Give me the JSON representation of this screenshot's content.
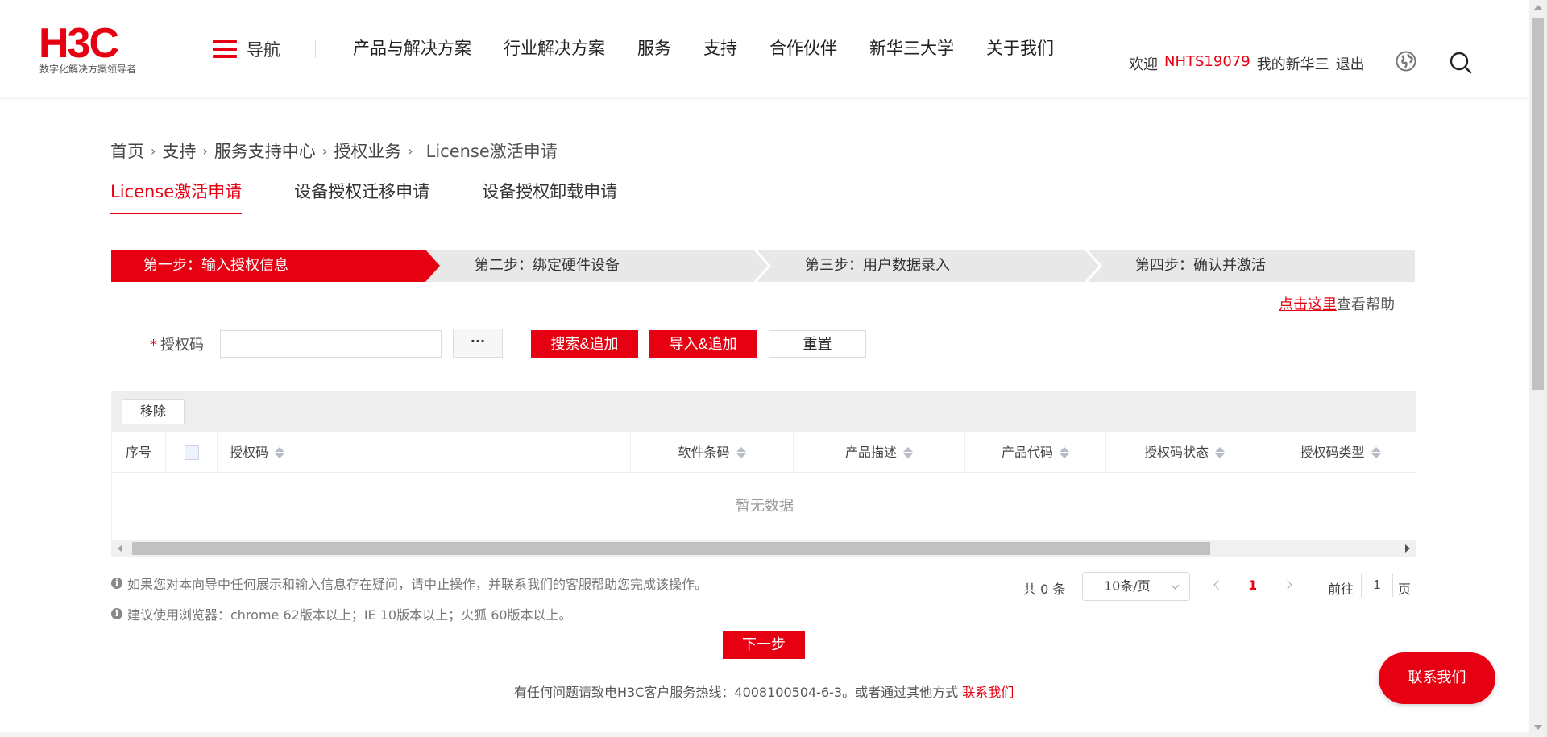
{
  "colors": {
    "brand_red": "#e60012",
    "step_inactive_bg": "#e8e8e8"
  },
  "header": {
    "logo_text": "H3C",
    "logo_slogan": "数字化解决方案领导者",
    "nav_toggle_label": "导航",
    "nav_items": [
      "产品与解决方案",
      "行业解决方案",
      "服务",
      "支持",
      "合作伙伴",
      "新华三大学",
      "关于我们"
    ],
    "welcome": "欢迎",
    "username": "NHTS19079",
    "my_h3c": "我的新华三",
    "logout": "退出",
    "globe_icon": "globe-icon",
    "search_icon": "search-icon"
  },
  "breadcrumb": {
    "items": [
      "首页",
      "支持",
      "服务支持中心",
      "授权业务"
    ],
    "separator": "›",
    "current": "License激活申请"
  },
  "tabs": [
    "License激活申请",
    "设备授权迁移申请",
    "设备授权卸载申请"
  ],
  "steps": [
    "第一步：输入授权信息",
    "第二步：绑定硬件设备",
    "第三步：用户数据录入",
    "第四步：确认并激活"
  ],
  "help": {
    "link": "点击这里",
    "text": "查看帮助"
  },
  "form": {
    "required_mark": "*",
    "code_label": "授权码",
    "code_value": "",
    "code_placeholder": "",
    "more_label": "···",
    "search_add": "搜索&追加",
    "import_add": "导入&追加",
    "reset": "重置"
  },
  "table": {
    "remove": "移除",
    "columns": [
      "序号",
      "",
      "授权码",
      "软件条码",
      "产品描述",
      "产品代码",
      "授权码状态",
      "授权码类型"
    ],
    "empty_text": "暂无数据"
  },
  "notes": [
    "如果您对本向导中任何展示和输入信息存在疑问，请中止操作，并联系我们的客服帮助您完成该操作。",
    "建议使用浏览器：chrome 62版本以上；IE 10版本以上；火狐 60版本以上。"
  ],
  "info_icon_glyph": "i",
  "pagination": {
    "total": "共 0 条",
    "page_size": "10条/页",
    "current_page": "1",
    "goto_label": "前往",
    "goto_value": "1",
    "page_suffix": "页"
  },
  "next_button": "下一步",
  "footer": {
    "text": "有任何问题请致电H3C客户服务热线：4008100504-6-3。或者通过其他方式",
    "link": "联系我们"
  },
  "contact_button": "联系我们"
}
